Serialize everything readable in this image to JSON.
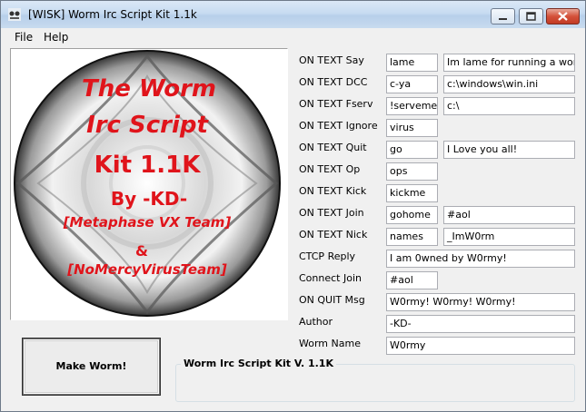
{
  "window": {
    "title": "[WISK] Worm Irc Script Kit 1.1k"
  },
  "menu": {
    "items": [
      "File",
      "Help"
    ]
  },
  "logo": {
    "lines": [
      "The Worm",
      "Irc Script",
      "Kit 1.1K",
      "By -KD-",
      "[Metaphase VX Team]",
      "&",
      "[NoMercyVirusTeam]"
    ]
  },
  "fields": [
    {
      "label": "ON TEXT Say",
      "value1": "lame",
      "value2": "Im lame for running a worm"
    },
    {
      "label": "ON TEXT DCC",
      "value1": "c-ya",
      "value2": "c:\\windows\\win.ini"
    },
    {
      "label": "ON TEXT Fserv",
      "value1": "!serveme",
      "value2": "c:\\"
    },
    {
      "label": "ON TEXT Ignore",
      "value1": "virus"
    },
    {
      "label": "ON TEXT Quit",
      "value1": "go",
      "value2": "I Love you all!"
    },
    {
      "label": "ON TEXT Op",
      "value1": "ops"
    },
    {
      "label": "ON TEXT Kick",
      "value1": "kickme"
    },
    {
      "label": "ON TEXT Join",
      "value1": "gohome",
      "value2": "#aol"
    },
    {
      "label": "ON TEXT Nick",
      "value1": "names",
      "value2": "_ImW0rm"
    },
    {
      "label": "CTCP Reply",
      "wide": "I am 0wned by W0rmy!"
    },
    {
      "label": "Connect Join",
      "value1": "#aol"
    },
    {
      "label": "ON QUIT Msg",
      "wide": "W0rmy! W0rmy! W0rmy!"
    },
    {
      "label": "Author",
      "wide": "-KD-"
    },
    {
      "label": "Worm Name",
      "wide": "W0rmy"
    }
  ],
  "buttons": {
    "make_worm": "Make Worm!"
  },
  "status_group": {
    "title": "Worm Irc Script Kit V. 1.1K"
  },
  "colors": {
    "logo_text": "#e0141b",
    "title_gradient_top": "#dbe8f6",
    "close_button": "#c94530"
  }
}
